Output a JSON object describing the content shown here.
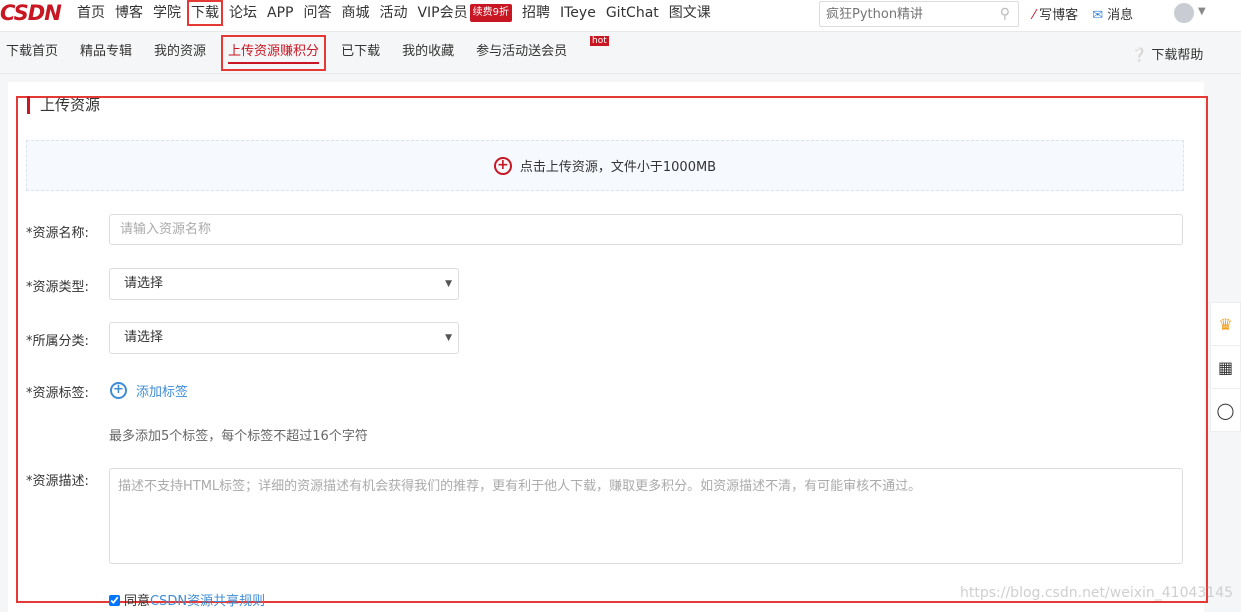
{
  "header": {
    "logo": "CSDN",
    "nav": [
      "首页",
      "博客",
      "学院",
      "下载",
      "论坛",
      "APP",
      "问答",
      "商城",
      "活动",
      "VIP会员"
    ],
    "vip_badge": "续费9折",
    "nav2": [
      "招聘",
      "ITeye",
      "GitChat",
      "图文课"
    ],
    "search_placeholder": "疯狂Python精讲",
    "write_blog": "写博客",
    "messages": "消息"
  },
  "subnav": {
    "items": [
      "下载首页",
      "精品专辑",
      "我的资源",
      "上传资源赚积分",
      "已下载",
      "我的收藏",
      "参与活动送会员"
    ],
    "hot": "hot",
    "help": "下载帮助"
  },
  "form": {
    "section_title": "上传资源",
    "upload_text": "点击上传资源，文件小于1000MB",
    "name_label": "*资源名称:",
    "name_placeholder": "请输入资源名称",
    "type_label": "*资源类型:",
    "type_value": "请选择",
    "category_label": "*所属分类:",
    "category_value": "请选择",
    "tags_label": "*资源标签:",
    "add_tag": "添加标签",
    "tags_hint": "最多添加5个标签，每个标签不超过16个字符",
    "desc_label": "*资源描述:",
    "desc_placeholder": "描述不支持HTML标签；详细的资源描述有机会获得我们的推荐，更有利于他人下载，赚取更多积分。如资源描述不清，有可能审核不通过。",
    "agree_text": "同意",
    "agree_link": "CSDN资源共享规则"
  },
  "watermark": "https://blog.csdn.net/weixin_41043145",
  "colors": {
    "accent": "#c81623",
    "link": "#3f8dd6",
    "highlight": "#e53935"
  }
}
